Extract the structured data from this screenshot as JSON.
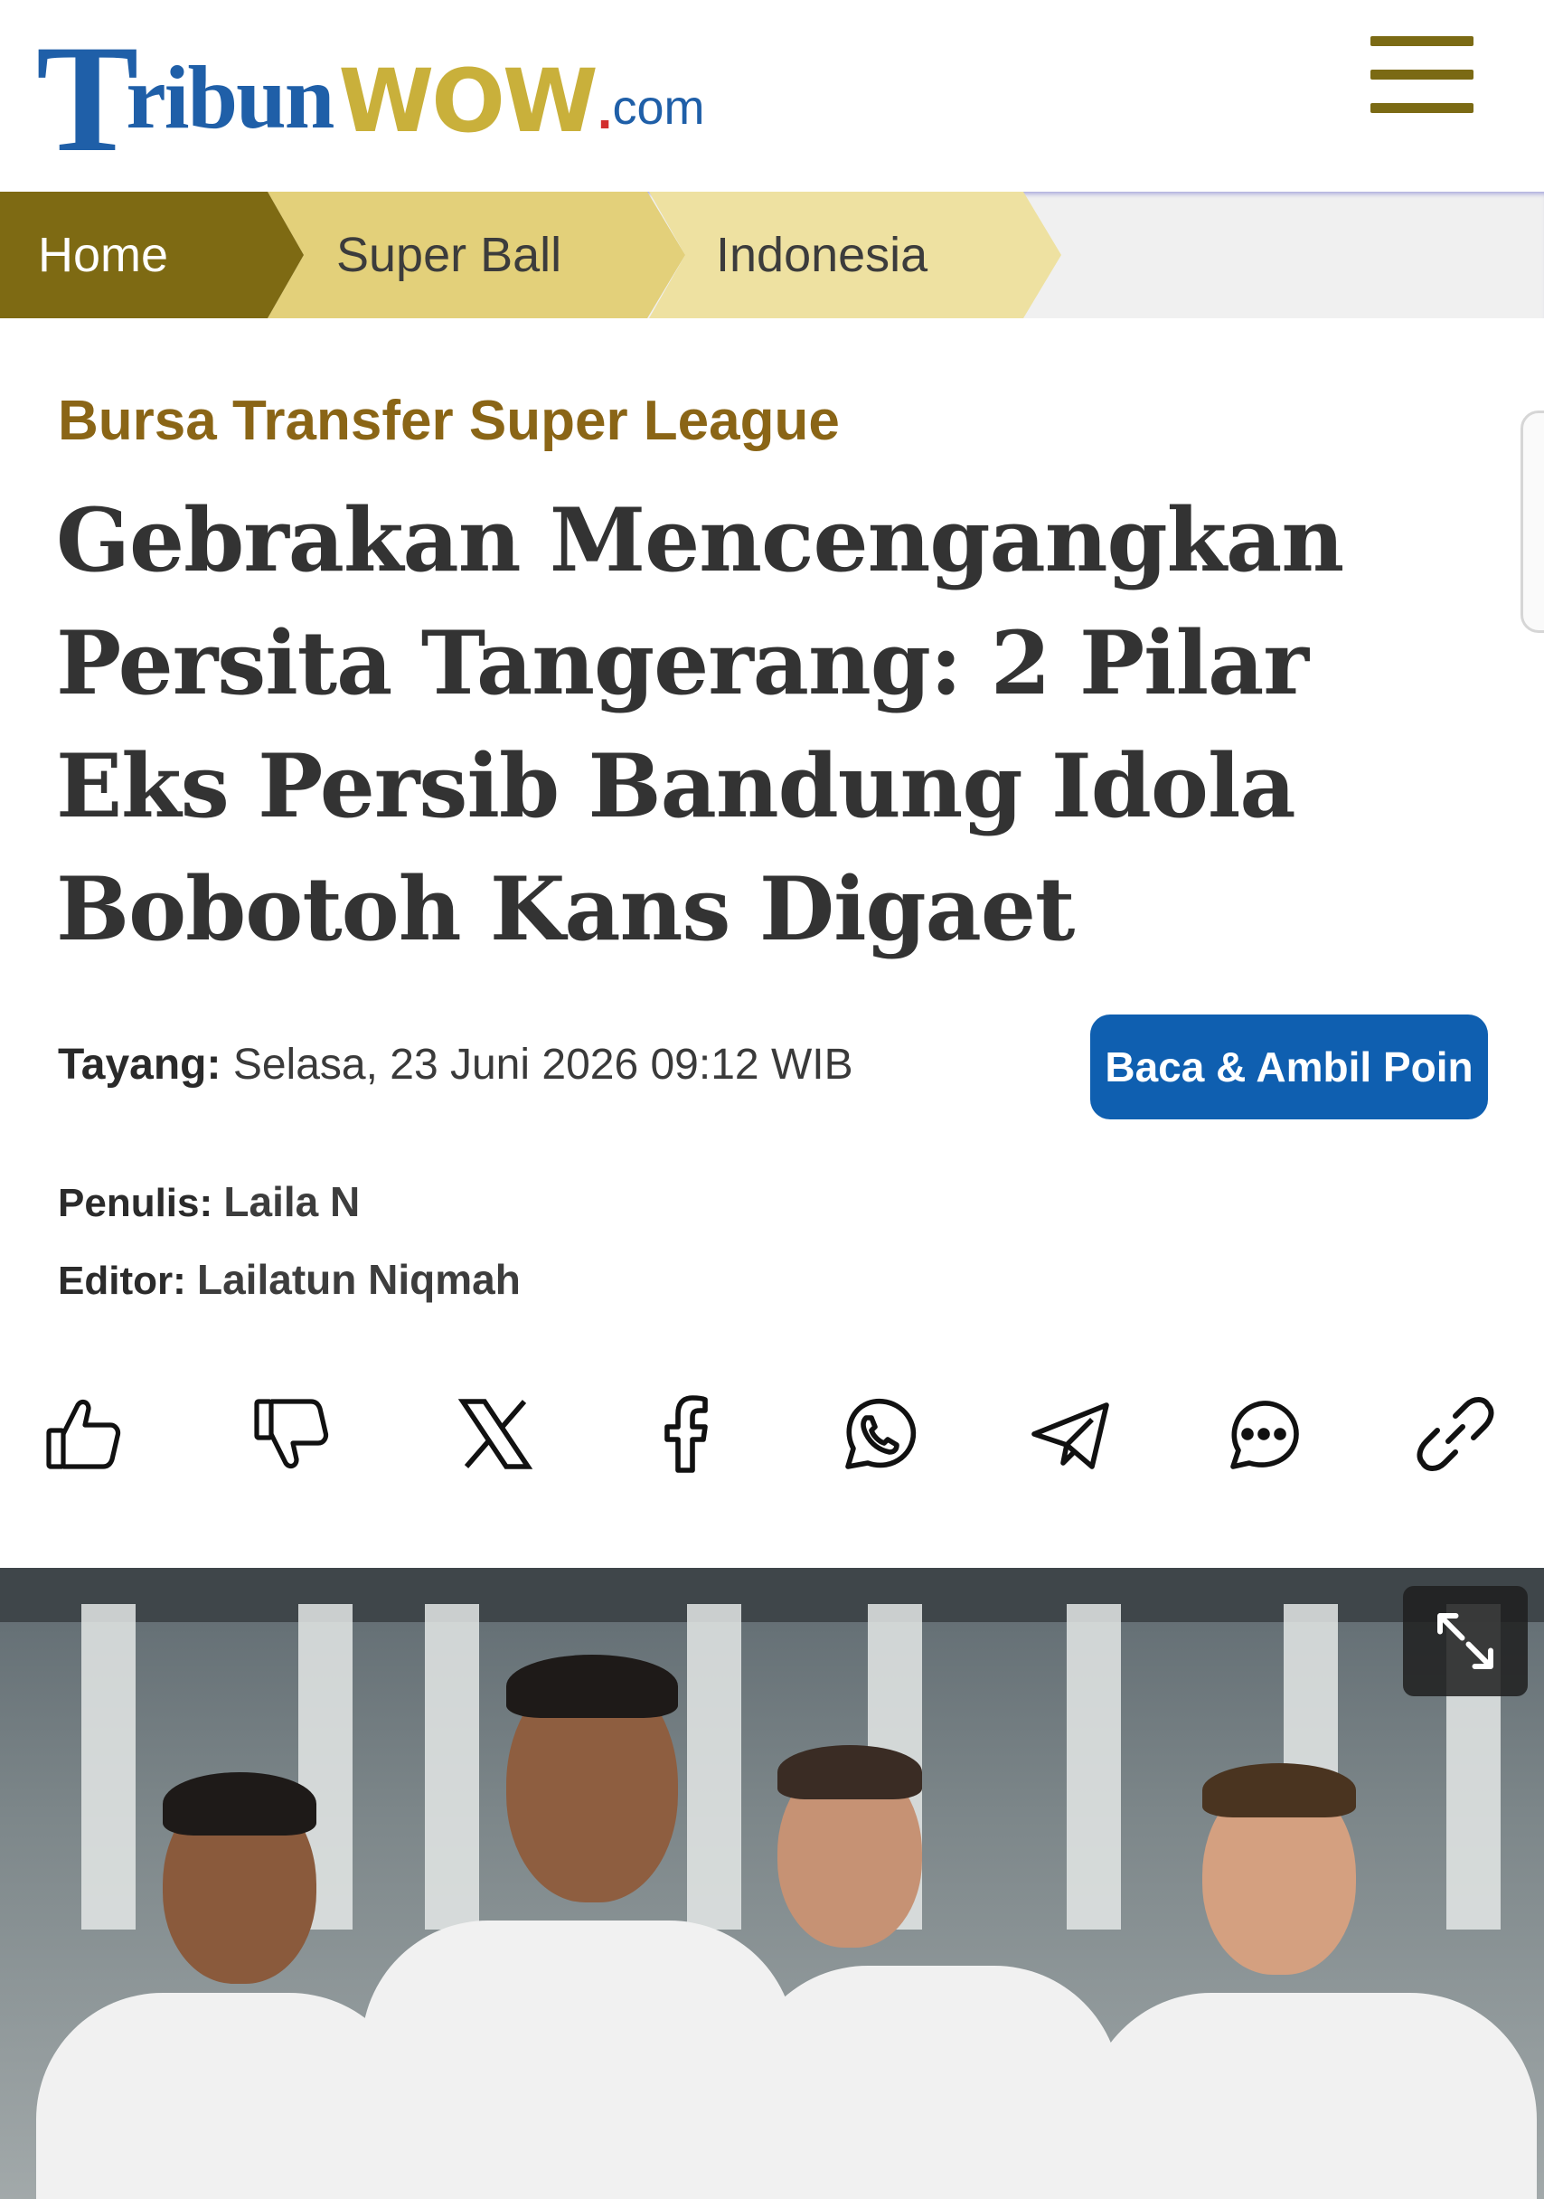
{
  "header": {
    "logo": {
      "part1": "T",
      "part2": "ribun",
      "part3": "WOW",
      "dot": ".",
      "part4": "com"
    },
    "menu_icon": "hamburger-menu-icon"
  },
  "breadcrumb": {
    "items": [
      "Home",
      "Super Ball",
      "Indonesia"
    ]
  },
  "article": {
    "kicker": "Bursa Transfer Super League",
    "title": "Gebrakan Mencengangkan Persita Tangerang: 2 Pilar Eks Persib Bandung Idola Bobotoh Kans Digaet",
    "published_label": "Tayang:",
    "published_value": "Selasa, 23 Juni 2026 09:12 WIB",
    "cta_label": "Baca & Ambil Poin",
    "writer_label": "Penulis:",
    "writer_value": "Laila N",
    "editor_label": "Editor:",
    "editor_value": "Lailatun Niqmah"
  },
  "share_icons": [
    "thumbs-up-icon",
    "thumbs-down-icon",
    "x-icon",
    "facebook-icon",
    "whatsapp-icon",
    "telegram-icon",
    "comment-icon",
    "link-icon"
  ],
  "colors": {
    "brand_blue": "#1f5fa8",
    "brand_gold": "#c9b03b",
    "breadcrumb_home": "#7e6a13",
    "kicker": "#8a6516",
    "cta": "#0f5fb0"
  }
}
